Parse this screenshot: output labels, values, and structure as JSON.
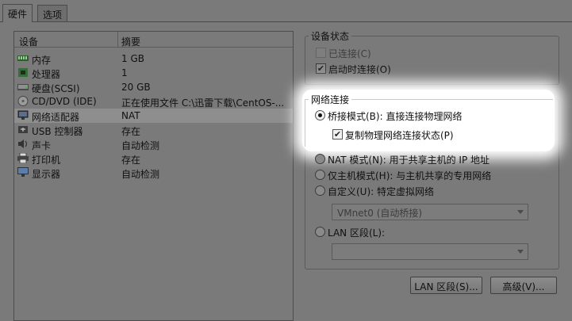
{
  "tabs": [
    "硬件",
    "选项"
  ],
  "devices": {
    "header": {
      "device": "设备",
      "summary": "摘要"
    },
    "rows": [
      {
        "name": "内存",
        "summary": "1 GB",
        "icon": "memory-icon"
      },
      {
        "name": "处理器",
        "summary": "1",
        "icon": "cpu-icon"
      },
      {
        "name": "硬盘(SCSI)",
        "summary": "20 GB",
        "icon": "disk-icon"
      },
      {
        "name": "CD/DVD (IDE)",
        "summary": "正在使用文件 C:\\迅雷下载\\CentOS-...",
        "icon": "cd-icon"
      },
      {
        "name": "网络适配器",
        "summary": "NAT",
        "icon": "network-icon"
      },
      {
        "name": "USB 控制器",
        "summary": "存在",
        "icon": "usb-icon"
      },
      {
        "name": "声卡",
        "summary": "自动检测",
        "icon": "sound-icon"
      },
      {
        "name": "打印机",
        "summary": "存在",
        "icon": "printer-icon"
      },
      {
        "name": "显示器",
        "summary": "自动检测",
        "icon": "monitor-icon"
      }
    ]
  },
  "device_status": {
    "title": "设备状态",
    "connected": "已连接(C)",
    "connect_at_power_on": "启动时连接(O)"
  },
  "network": {
    "title": "网络连接",
    "bridged": "桥接模式(B): 直接连接物理网络",
    "replicate": "复制物理网络连接状态(P)",
    "nat": "NAT 模式(N): 用于共享主机的 IP 地址",
    "host_only": "仅主机模式(H): 与主机共享的专用网络",
    "custom": "自定义(U): 特定虚拟网络",
    "custom_select": "VMnet0 (自动桥接)",
    "lan_segment": "LAN 区段(L):",
    "lan_select": ""
  },
  "buttons": {
    "lan_segments": "LAN 区段(S)...",
    "advanced": "高级(V)..."
  }
}
